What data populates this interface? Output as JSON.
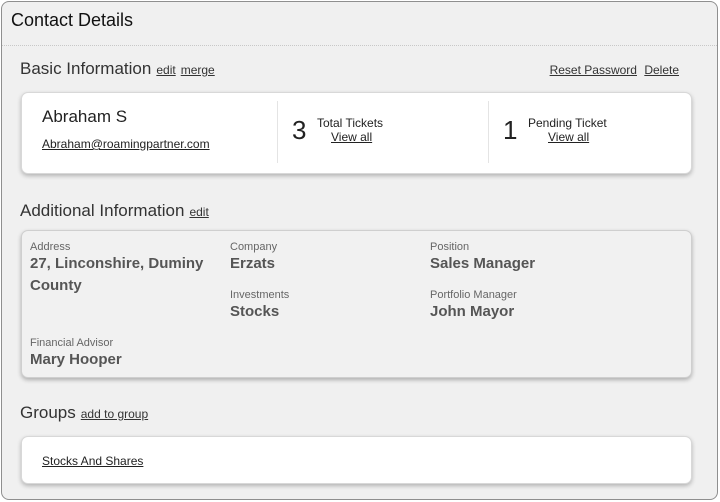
{
  "window": {
    "title": "Contact Details"
  },
  "basic": {
    "title": "Basic Information",
    "edit_label": "edit",
    "merge_label": "merge",
    "reset_password_label": "Reset Password",
    "delete_label": "Delete",
    "name": "Abraham S",
    "email": "Abraham@roamingpartner.com",
    "total_tickets": {
      "count": "3",
      "label": "Total Tickets",
      "link": "View all"
    },
    "pending_tickets": {
      "count": "1",
      "label": "Pending Ticket",
      "link": "View all"
    }
  },
  "additional": {
    "title": "Additional Information",
    "edit_label": "edit",
    "address": {
      "label": "Address",
      "value": "27, Linconshire, Duminy County"
    },
    "company": {
      "label": "Company",
      "value": "Erzats"
    },
    "position": {
      "label": "Position",
      "value": "Sales Manager"
    },
    "investments": {
      "label": "Investments",
      "value": "Stocks"
    },
    "portfolio_manager": {
      "label": "Portfolio Manager",
      "value": "John Mayor"
    },
    "financial_advisor": {
      "label": "Financial Advisor",
      "value": "Mary Hooper"
    }
  },
  "groups": {
    "title": "Groups",
    "add_label": "add to group",
    "items": [
      "Stocks And Shares"
    ]
  }
}
